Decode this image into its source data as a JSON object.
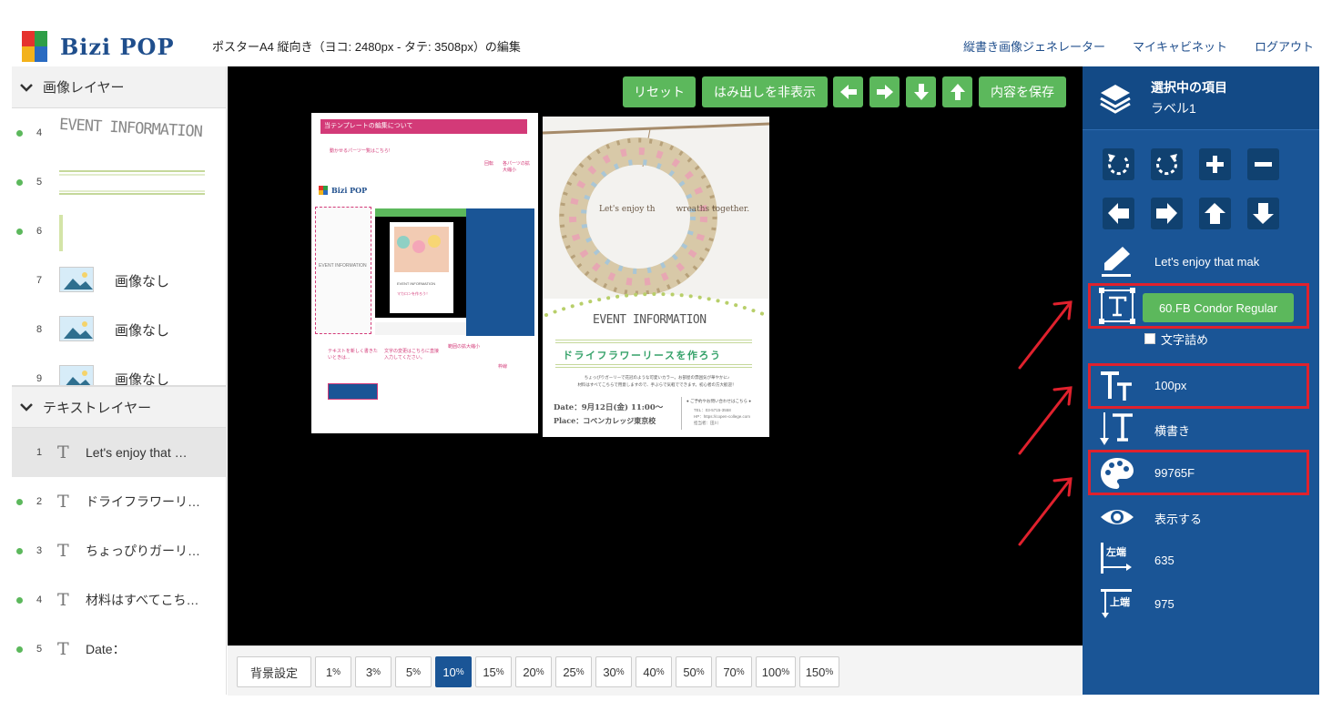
{
  "header": {
    "logo_text": "Bizi POP",
    "page_title": "ポスターA4 縦向き（ヨコ: 2480px - タテ: 3508px）の編集",
    "nav": [
      "縦書き画像ジェネレーター",
      "マイキャビネット",
      "ログアウト"
    ]
  },
  "left_panel": {
    "image_section_title": "画像レイヤー",
    "image_layers": [
      {
        "num": "4",
        "type": "event-information-image"
      },
      {
        "num": "5",
        "type": "double-line-image"
      },
      {
        "num": "6",
        "type": "vertical-line-image"
      },
      {
        "num": "7",
        "label": "画像なし"
      },
      {
        "num": "8",
        "label": "画像なし"
      },
      {
        "num": "9",
        "label": "画像なし"
      }
    ],
    "event_info_thumb_text": "EVENT INFORMATION",
    "text_section_title": "テキストレイヤー",
    "text_layers": [
      {
        "num": "1",
        "label": "Let's enjoy that …"
      },
      {
        "num": "2",
        "label": "ドライフラワーリ…"
      },
      {
        "num": "3",
        "label": "ちょっぴりガーリ…"
      },
      {
        "num": "4",
        "label": "材料はすべてこち…"
      },
      {
        "num": "5",
        "label": "Date："
      }
    ]
  },
  "toolbar": {
    "reset": "リセット",
    "toggle_overflow": "はみ出しを非表示",
    "save": "内容を保存"
  },
  "poster1": {
    "header": "当テンプレートの編集について",
    "logo_text": "Bizi POP",
    "note1": "動かせるパーツ一覧はこちら!",
    "note2": "回転",
    "note3": "各パーツの拡大縮小",
    "note4": "テキストを新しく書きたいときは...",
    "note5": "文字の変更はこちらに直接入力してください。",
    "note6": "範囲の拡大縮小",
    "note7": "枠線",
    "event_text": "EVENT INFORMATION",
    "sub_text": "マカロンを作ろう！"
  },
  "poster2": {
    "overlay_text": "Let's enjoy th        wreaths together.",
    "event_text": "EVENT INFORMATION",
    "title": "ドライフラワーリースを作ろう",
    "body1": "ちょっぴりガーリーで花冠のような可愛いカラー。お部屋の雰囲気が華やかに♪",
    "body2": "材料はすべてこちらで用意しますので、手ぶらで気軽でできます。初心者の方大歓迎！",
    "date": "Date：9月12日(金) 11:00～",
    "place": "Place：コペンカレッジ東京校",
    "contact1": "● ご予約やお問い合わせはこちら ●",
    "contact2": "TEL：03-5715-3558",
    "contact3": "HP：https://copen-college.com",
    "contact4": "担当者：田川"
  },
  "zoom": {
    "background_settings": "背景設定",
    "levels": [
      "1",
      "3",
      "5",
      "10",
      "15",
      "20",
      "25",
      "30",
      "40",
      "50",
      "70",
      "100",
      "150"
    ],
    "unit": "%",
    "active": "10"
  },
  "right_panel": {
    "selected_title": "選択中の項目",
    "selected_name": "ラベル1",
    "text_value": "Let's enjoy that mak",
    "font_name": "60.FB Condor Regular",
    "kerning_label": "文字詰め",
    "font_size": "100px",
    "orientation": "横書き",
    "color_value": "99765F",
    "visibility": "表示する",
    "left_label": "左端",
    "left_value": "635",
    "top_label": "上端",
    "top_value": "975"
  },
  "colors": {
    "accent_green": "#5cb85c",
    "panel_blue": "#1a5596",
    "highlight_red": "#e0212d"
  }
}
